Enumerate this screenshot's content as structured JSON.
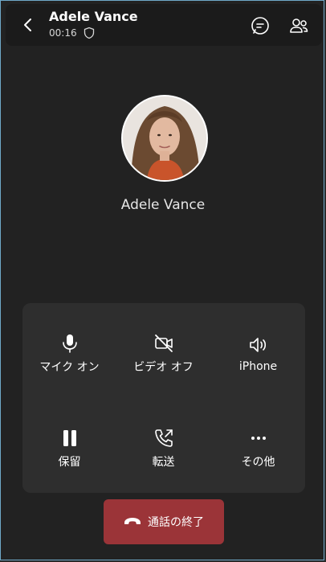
{
  "header": {
    "contact_name": "Adele Vance",
    "call_timer": "00:16"
  },
  "caller": {
    "name": "Adele Vance"
  },
  "controls": {
    "mic": {
      "label": "マイク オン",
      "icon": "microphone-icon"
    },
    "video": {
      "label": "ビデオ オフ",
      "icon": "video-off-icon"
    },
    "audio": {
      "label": "iPhone",
      "icon": "speaker-icon"
    },
    "hold": {
      "label": "保留",
      "icon": "pause-icon"
    },
    "transfer": {
      "label": "転送",
      "icon": "phone-transfer-icon"
    },
    "more": {
      "label": "その他",
      "icon": "more-icon"
    }
  },
  "end_call": {
    "label": "通話の終了",
    "color": "#9b3438"
  }
}
